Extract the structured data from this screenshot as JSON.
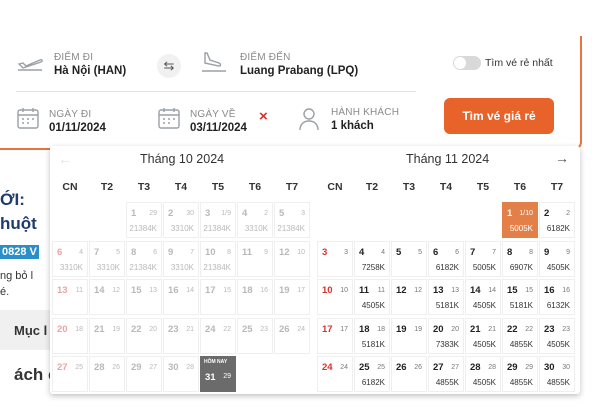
{
  "form": {
    "from": {
      "label": "ĐIỂM ĐI",
      "value": "Hà Nội (HAN)"
    },
    "to": {
      "label": "ĐIỂM ĐẾN",
      "value": "Luang Prabang (LPQ)"
    },
    "depart": {
      "label": "NGÀY ĐI",
      "value": "01/11/2024"
    },
    "return": {
      "label": "NGÀY VỀ",
      "value": "03/11/2024"
    },
    "passengers": {
      "label": "HÀNH KHÁCH",
      "value": "1 khách"
    },
    "cheapest_toggle_label": "Tìm vé rẻ nhất",
    "search_button": "Tìm vé giá rẻ",
    "clear_icon": "×",
    "swap_icon": "⇆"
  },
  "background_article": {
    "line1": "ỚI:",
    "line2": "huột",
    "line3": "0828 V",
    "line4": "ng bỏ l",
    "line5": "é.",
    "line6": "Mục l",
    "line7": "ách c"
  },
  "calendar": {
    "weekdays": [
      "CN",
      "T2",
      "T3",
      "T4",
      "T5",
      "T6",
      "T7"
    ],
    "prev_icon": "←",
    "next_icon": "→",
    "months": [
      {
        "title": "Tháng 10 2024",
        "weeks": [
          [
            null,
            null,
            {
              "d": "1",
              "l": "29",
              "p": "21384K",
              "past": true
            },
            {
              "d": "2",
              "l": "30",
              "p": "3310K",
              "past": true
            },
            {
              "d": "3",
              "l": "1/9",
              "p": "21384K",
              "past": true
            },
            {
              "d": "4",
              "l": "2",
              "p": "3310K",
              "past": true
            },
            {
              "d": "5",
              "l": "3",
              "p": "21384K",
              "past": true
            }
          ],
          [
            {
              "d": "6",
              "l": "4",
              "p": "3310K",
              "past": true,
              "sun": true
            },
            {
              "d": "7",
              "l": "5",
              "p": "3310K",
              "past": true
            },
            {
              "d": "8",
              "l": "6",
              "p": "21384K",
              "past": true
            },
            {
              "d": "9",
              "l": "7",
              "p": "3310K",
              "past": true
            },
            {
              "d": "10",
              "l": "8",
              "p": "21384K",
              "past": true
            },
            {
              "d": "11",
              "l": "9",
              "p": "",
              "past": true
            },
            {
              "d": "12",
              "l": "10",
              "p": "",
              "past": true
            }
          ],
          [
            {
              "d": "13",
              "l": "11",
              "p": "",
              "past": true,
              "sun": true
            },
            {
              "d": "14",
              "l": "12",
              "p": "",
              "past": true
            },
            {
              "d": "15",
              "l": "13",
              "p": "",
              "past": true
            },
            {
              "d": "16",
              "l": "14",
              "p": "",
              "past": true
            },
            {
              "d": "17",
              "l": "15",
              "p": "",
              "past": true
            },
            {
              "d": "18",
              "l": "16",
              "p": "",
              "past": true
            },
            {
              "d": "19",
              "l": "17",
              "p": "",
              "past": true
            }
          ],
          [
            {
              "d": "20",
              "l": "18",
              "p": "",
              "past": true,
              "sun": true
            },
            {
              "d": "21",
              "l": "19",
              "p": "",
              "past": true
            },
            {
              "d": "22",
              "l": "20",
              "p": "",
              "past": true
            },
            {
              "d": "23",
              "l": "21",
              "p": "",
              "past": true
            },
            {
              "d": "24",
              "l": "22",
              "p": "",
              "past": true
            },
            {
              "d": "25",
              "l": "23",
              "p": "",
              "past": true
            },
            {
              "d": "26",
              "l": "24",
              "p": "",
              "past": true
            }
          ],
          [
            {
              "d": "27",
              "l": "25",
              "p": "",
              "past": true,
              "sun": true
            },
            {
              "d": "28",
              "l": "26",
              "p": "",
              "past": true
            },
            {
              "d": "29",
              "l": "27",
              "p": "",
              "past": true
            },
            {
              "d": "30",
              "l": "28",
              "p": "",
              "past": true
            },
            {
              "d": "31",
              "l": "29",
              "p": "",
              "today": true,
              "tag": "HÔM NAY"
            },
            null,
            null
          ]
        ]
      },
      {
        "title": "Tháng 11 2024",
        "weeks": [
          [
            null,
            null,
            null,
            null,
            null,
            {
              "d": "1",
              "l": "1/10",
              "p": "5005K",
              "selected": true
            },
            {
              "d": "2",
              "l": "2",
              "p": "6182K"
            }
          ],
          [
            {
              "d": "3",
              "l": "3",
              "p": "",
              "sun": true
            },
            {
              "d": "4",
              "l": "4",
              "p": "7258K"
            },
            {
              "d": "5",
              "l": "5",
              "p": ""
            },
            {
              "d": "6",
              "l": "6",
              "p": "6182K"
            },
            {
              "d": "7",
              "l": "7",
              "p": "5005K"
            },
            {
              "d": "8",
              "l": "8",
              "p": "6907K"
            },
            {
              "d": "9",
              "l": "9",
              "p": "4505K"
            }
          ],
          [
            {
              "d": "10",
              "l": "10",
              "p": "",
              "sun": true
            },
            {
              "d": "11",
              "l": "11",
              "p": "4505K"
            },
            {
              "d": "12",
              "l": "12",
              "p": ""
            },
            {
              "d": "13",
              "l": "13",
              "p": "5181K"
            },
            {
              "d": "14",
              "l": "14",
              "p": "4505K"
            },
            {
              "d": "15",
              "l": "15",
              "p": "5181K"
            },
            {
              "d": "16",
              "l": "16",
              "p": "6132K"
            }
          ],
          [
            {
              "d": "17",
              "l": "17",
              "p": "",
              "sun": true
            },
            {
              "d": "18",
              "l": "18",
              "p": "5181K"
            },
            {
              "d": "19",
              "l": "19",
              "p": ""
            },
            {
              "d": "20",
              "l": "20",
              "p": "7383K"
            },
            {
              "d": "21",
              "l": "21",
              "p": "4505K"
            },
            {
              "d": "22",
              "l": "22",
              "p": "4855K"
            },
            {
              "d": "23",
              "l": "23",
              "p": "4505K"
            }
          ],
          [
            {
              "d": "24",
              "l": "24",
              "p": "",
              "sun": true
            },
            {
              "d": "25",
              "l": "25",
              "p": "6182K"
            },
            {
              "d": "26",
              "l": "26",
              "p": ""
            },
            {
              "d": "27",
              "l": "27",
              "p": "4855K"
            },
            {
              "d": "28",
              "l": "28",
              "p": "4505K"
            },
            {
              "d": "29",
              "l": "29",
              "p": "4855K"
            },
            {
              "d": "30",
              "l": "30",
              "p": "4855K"
            }
          ]
        ]
      }
    ]
  }
}
